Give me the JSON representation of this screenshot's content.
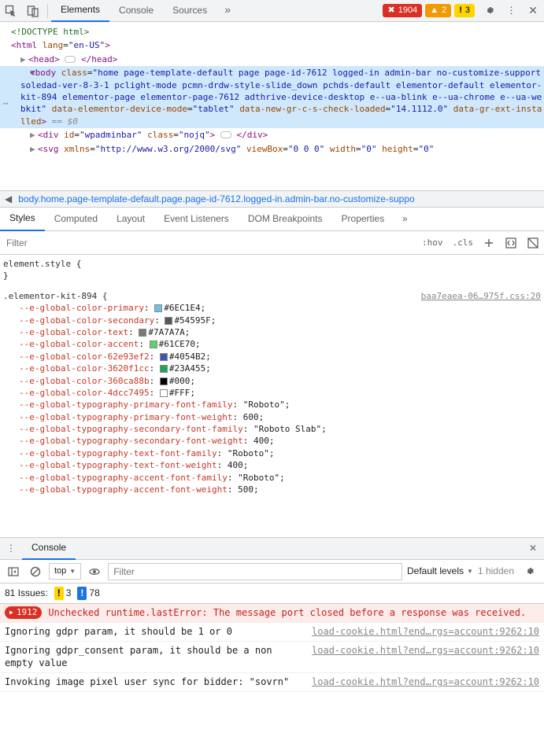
{
  "toolbar": {
    "tabs": [
      "Elements",
      "Console",
      "Sources"
    ],
    "active": 0,
    "errors": "1904",
    "warnings": "2",
    "info": "3"
  },
  "dom": {
    "doctype": "<!DOCTYPE html>",
    "html_tag": "html",
    "html_attr": "lang",
    "html_val": "en-US",
    "head": "head",
    "body_tag": "body",
    "body_class_attr": "class",
    "body_class_val": "home page-template-default page page-id-7612 logged-in admin-bar no-customize-support soledad-ver-8-3-1 pclight-mode pcmn-drdw-style-slide_down pchds-default elementor-default elementor-kit-894 elementor-page elementor-page-7612 adthrive-device-desktop e--ua-blink e--ua-chrome e--ua-webkit",
    "body_attr2": "data-elementor-device-mode",
    "body_val2": "tablet",
    "body_attr3": "data-new-gr-c-s-check-loaded",
    "body_val3": "14.1112.0",
    "body_attr4": "data-gr-ext-installed",
    "eq0": "== $0",
    "div_tag": "div",
    "div_id_attr": "id",
    "div_id_val": "wpadminbar",
    "div_class_attr": "class",
    "div_class_val": "nojq",
    "svg_tag": "svg",
    "svg_xmlns_attr": "xmlns",
    "svg_xmlns_val": "http://www.w3.org/2000/svg",
    "svg_vb_attr": "viewBox",
    "svg_vb_val": "0 0 0",
    "svg_w_attr": "width",
    "svg_w_val": "0",
    "svg_h_attr": "height",
    "svg_h_val": "0"
  },
  "breadcrumb": "body.home.page-template-default.page.page-id-7612.logged-in.admin-bar.no-customize-suppo",
  "stylesTabs": [
    "Styles",
    "Computed",
    "Layout",
    "Event Listeners",
    "DOM Breakpoints",
    "Properties"
  ],
  "filter_placeholder": "Filter",
  "hov": ":hov",
  "cls": ".cls",
  "rule1": {
    "selector": "element.style",
    "open": "{",
    "close": "}"
  },
  "rule2": {
    "selector": ".elementor-kit-894 {",
    "link": "baa7eaea-06…975f.css:20",
    "props": [
      {
        "n": "--e-global-color-primary",
        "sw": "#6EC1E4",
        "v": "#6EC1E4;"
      },
      {
        "n": "--e-global-color-secondary",
        "sw": "#54595F",
        "v": "#54595F;"
      },
      {
        "n": "--e-global-color-text",
        "sw": "#7A7A7A",
        "v": "#7A7A7A;"
      },
      {
        "n": "--e-global-color-accent",
        "sw": "#61CE70",
        "v": "#61CE70;"
      },
      {
        "n": "--e-global-color-62e93ef2",
        "sw": "#4054B2",
        "v": "#4054B2;"
      },
      {
        "n": "--e-global-color-3620f1cc",
        "sw": "#23A455",
        "v": "#23A455;"
      },
      {
        "n": "--e-global-color-360ca88b",
        "sw": "#000000",
        "v": "#000;"
      },
      {
        "n": "--e-global-color-4dcc7495",
        "sw": "#FFFFFF",
        "v": "#FFF;"
      },
      {
        "n": "--e-global-typography-primary-font-family",
        "v": "\"Roboto\";"
      },
      {
        "n": "--e-global-typography-primary-font-weight",
        "v": "600;"
      },
      {
        "n": "--e-global-typography-secondary-font-family",
        "v": "\"Roboto Slab\";"
      },
      {
        "n": "--e-global-typography-secondary-font-weight",
        "v": "400;"
      },
      {
        "n": "--e-global-typography-text-font-family",
        "v": "\"Roboto\";"
      },
      {
        "n": "--e-global-typography-text-font-weight",
        "v": "400;"
      },
      {
        "n": "--e-global-typography-accent-font-family",
        "v": "\"Roboto\";"
      },
      {
        "n": "--e-global-typography-accent-font-weight",
        "v": "500;"
      }
    ]
  },
  "console": {
    "title": "Console",
    "top": "top",
    "filter_placeholder": "Filter",
    "levels": "Default levels",
    "hidden": "1 hidden",
    "issues_label": "81 Issues:",
    "issues_warn": "3",
    "issues_info": "78",
    "err_count": "1912",
    "err_text": "Unchecked runtime.lastError: The message port closed before a response was received.",
    "m1": "Ignoring gdpr param, it should be 1 or 0",
    "m1_src": "load-cookie.html?end…rgs=account:9262:10",
    "m2": "Ignoring gdpr_consent param, it should be a non empty value",
    "m2_src": "load-cookie.html?end…rgs=account:9262:10",
    "m3": "Invoking image pixel user sync for bidder: \"sovrn\"",
    "m3_src": "load-cookie.html?end…rgs=account:9262:10"
  }
}
